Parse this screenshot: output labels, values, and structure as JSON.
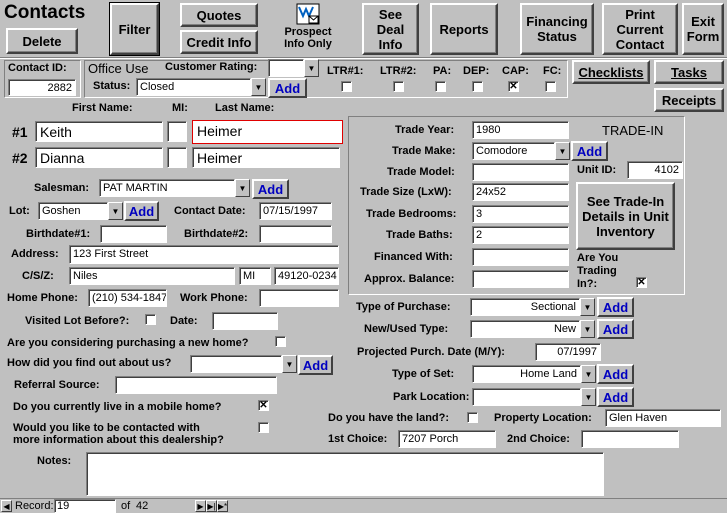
{
  "title": "Contacts",
  "toolbar": {
    "delete": "Delete",
    "filter": "Filter",
    "quotes": "Quotes",
    "credit_info": "Credit Info",
    "prospect": "Prospect Info Only",
    "see_deal_info": "See Deal Info",
    "reports": "Reports",
    "financing_status": "Financing Status",
    "print_current_contact": "Print Current Contact",
    "exit_form": "Exit Form"
  },
  "office": {
    "contact_id_label": "Contact ID:",
    "contact_id": "2882",
    "office_use_label": "Office Use",
    "customer_rating_label": "Customer Rating:",
    "customer_rating": "",
    "status_label": "Status:",
    "status": "Closed",
    "add": "Add",
    "flags": [
      {
        "label": "LTR#1:",
        "checked": false
      },
      {
        "label": "LTR#2:",
        "checked": false
      },
      {
        "label": "PA:",
        "checked": false
      },
      {
        "label": "DEP:",
        "checked": false
      },
      {
        "label": "CAP:",
        "checked": true
      },
      {
        "label": "FC:",
        "checked": false
      }
    ]
  },
  "side_buttons": {
    "checklists": "Checklists",
    "tasks": "Tasks",
    "receipts": "Receipts"
  },
  "names": {
    "first_name_label": "First Name:",
    "mi_label": "MI:",
    "last_name_label": "Last Name:",
    "row1_label": "#1",
    "row1_first": "Keith",
    "row1_mi": "",
    "row1_last": "Heimer",
    "row2_label": "#2",
    "row2_first": "Dianna",
    "row2_mi": "",
    "row2_last": "Heimer"
  },
  "details": {
    "salesman_label": "Salesman:",
    "salesman": "PAT MARTIN",
    "lot_label": "Lot:",
    "lot": "Goshen",
    "contact_date_label": "Contact Date:",
    "contact_date": "07/15/1997",
    "birthdate1_label": "Birthdate#1:",
    "birthdate1": "",
    "birthdate2_label": "Birthdate#2:",
    "birthdate2": "",
    "address_label": "Address:",
    "address": "123 First Street",
    "csz_label": "C/S/Z:",
    "city": "Niles",
    "state": "MI",
    "zip": "49120-0234",
    "home_phone_label": "Home Phone:",
    "home_phone": "(210) 534-1847",
    "work_phone_label": "Work Phone:",
    "work_phone": "",
    "visited_label": "Visited Lot Before?:",
    "visited": false,
    "date_label": "Date:",
    "date": "",
    "new_home_label": "Are you considering purchasing a new home?",
    "new_home": false,
    "find_out_label": "How did you find out about us?",
    "find_out": "",
    "referral_label": "Referral Source:",
    "referral": "",
    "mobile_home_label": "Do you currently live in a mobile home?",
    "mobile_home": true,
    "contacted_label_1": "Would you like to be contacted with",
    "contacted_label_2": "more information about this dealership?",
    "contacted": false,
    "notes_label": "Notes:",
    "notes": ""
  },
  "trade": {
    "header": "TRADE-IN",
    "year_label": "Trade Year:",
    "year": "1980",
    "make_label": "Trade Make:",
    "make": "Comodore",
    "model_label": "Trade Model:",
    "model": "",
    "size_label": "Trade Size (LxW):",
    "size": "24x52",
    "bedrooms_label": "Trade Bedrooms:",
    "bedrooms": "3",
    "baths_label": "Trade Baths:",
    "baths": "2",
    "financed_label": "Financed With:",
    "financed": "",
    "balance_label": "Approx. Balance:",
    "balance": "",
    "unit_id_label": "Unit ID:",
    "unit_id": "4102",
    "see_tradein": "See Trade-In Details in Unit Inventory",
    "trading_label": "Are You Trading In?:",
    "trading": true
  },
  "purchase": {
    "type_label": "Type of Purchase:",
    "type": "Sectional",
    "new_used_label": "New/Used Type:",
    "new_used": "New",
    "proj_date_label": "Projected Purch. Date (M/Y):",
    "proj_date": "07/1997",
    "set_label": "Type of Set:",
    "set": "Home Land",
    "park_label": "Park Location:",
    "park": "",
    "land_label": "Do you have the land?:",
    "land": false,
    "property_label": "Property Location:",
    "property": "Glen Haven",
    "first_choice_label": "1st Choice:",
    "first_choice": "7207 Porch",
    "second_choice_label": "2nd Choice:",
    "second_choice": ""
  },
  "navigation": {
    "record_label": "Record:",
    "record": "19",
    "of_label": "of",
    "total": "42"
  }
}
